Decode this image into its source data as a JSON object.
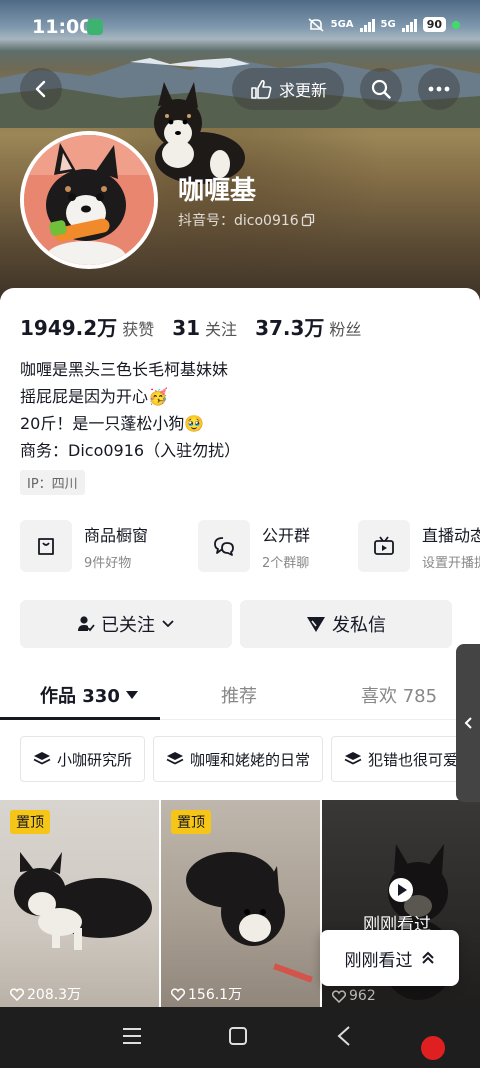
{
  "status_bar": {
    "time": "11:00",
    "net1": "5GA",
    "net2": "5G",
    "battery": "90"
  },
  "header": {
    "update_label": "求更新",
    "name": "咖喱基",
    "douyin_id": "抖音号：dico0916"
  },
  "stats": [
    {
      "value": "1949.2万",
      "label": "获赞"
    },
    {
      "value": "31",
      "label": "关注"
    },
    {
      "value": "37.3万",
      "label": "粉丝"
    }
  ],
  "bio": [
    "咖喱是黑头三色长毛柯基妹妹",
    "摇屁屁是因为开心🥳",
    "20斤！是一只蓬松小狗🥹",
    "商务：Dico0916（入驻勿扰）"
  ],
  "ip": "IP：四川",
  "services": [
    {
      "title": "商品橱窗",
      "subtitle": "9件好物",
      "icon": "bag-icon"
    },
    {
      "title": "公开群",
      "subtitle": "2个群聊",
      "icon": "group-chat-icon"
    },
    {
      "title": "直播动态",
      "subtitle": "设置开播提醒",
      "icon": "live-tv-icon"
    }
  ],
  "actions": {
    "follow_label": "已关注",
    "message_label": "发私信"
  },
  "tabs": [
    {
      "label": "作品 330"
    },
    {
      "label": "推荐"
    },
    {
      "label": "喜欢 785"
    }
  ],
  "collections": [
    "小咖研究所",
    "咖喱和姥姥的日常",
    "犯错也很可爱"
  ],
  "videos": [
    {
      "pinned": "置顶",
      "likes": "208.3万"
    },
    {
      "pinned": "置顶",
      "likes": "156.1万"
    },
    {
      "overlay": "刚刚看过",
      "likes": "962"
    }
  ],
  "float_button": "刚刚看过",
  "colors": {
    "accent_pin": "#f5c518",
    "record": "#e02020",
    "text": "#161823"
  }
}
